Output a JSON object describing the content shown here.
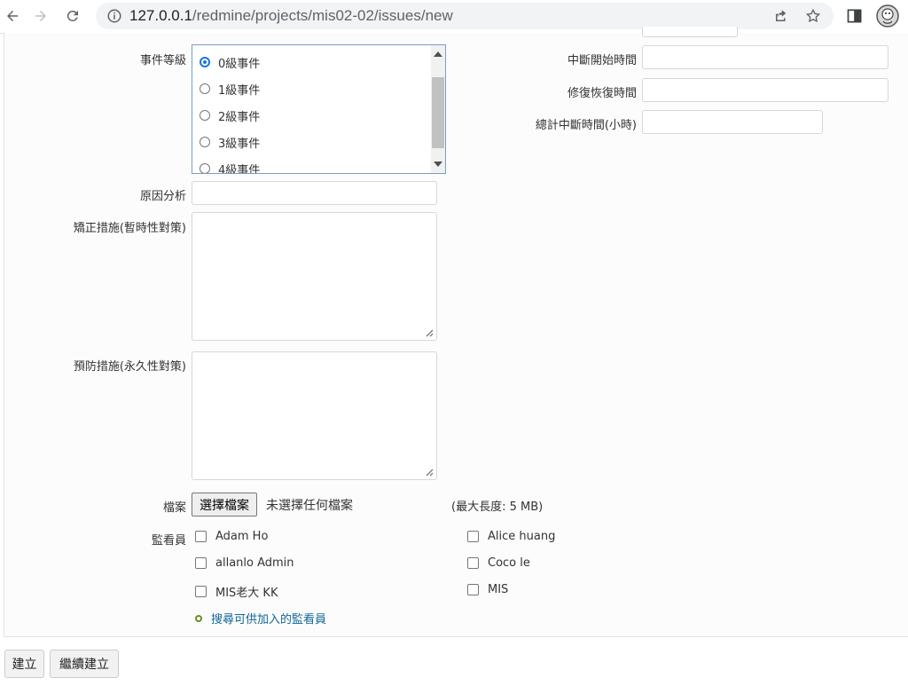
{
  "browser": {
    "url_host": "127.0.0.1",
    "url_path": "/redmine/projects/mis02-02/issues/new"
  },
  "form": {
    "event_level": {
      "label": "事件等級",
      "options": [
        "0級事件",
        "1級事件",
        "2級事件",
        "3級事件",
        "4級事件"
      ],
      "selected": "0級事件"
    },
    "interrupt_start": {
      "label": "中斷開始時間",
      "value": ""
    },
    "repair_time": {
      "label": "修復恢復時間",
      "value": ""
    },
    "total_interrupt": {
      "label": "總計中斷時間(小時)",
      "value": ""
    },
    "cause_analysis": {
      "label": "原因分析",
      "value": ""
    },
    "corrective": {
      "label": "矯正措施(暫時性對策)",
      "value": ""
    },
    "preventive": {
      "label": "預防措施(永久性對策)",
      "value": ""
    },
    "files": {
      "label": "檔案",
      "button": "選擇檔案",
      "none_selected": "未選擇任何檔案",
      "max_size": "(最大長度: 5 MB)"
    },
    "watchers": {
      "label": "監看員",
      "people": [
        "Adam Ho",
        "Alice huang",
        "allanlo Admin",
        "Coco le",
        "MIS老大 KK",
        "MIS"
      ],
      "search_link": "搜尋可供加入的監看員"
    }
  },
  "actions": {
    "create": "建立",
    "continue_create": "繼續建立"
  }
}
